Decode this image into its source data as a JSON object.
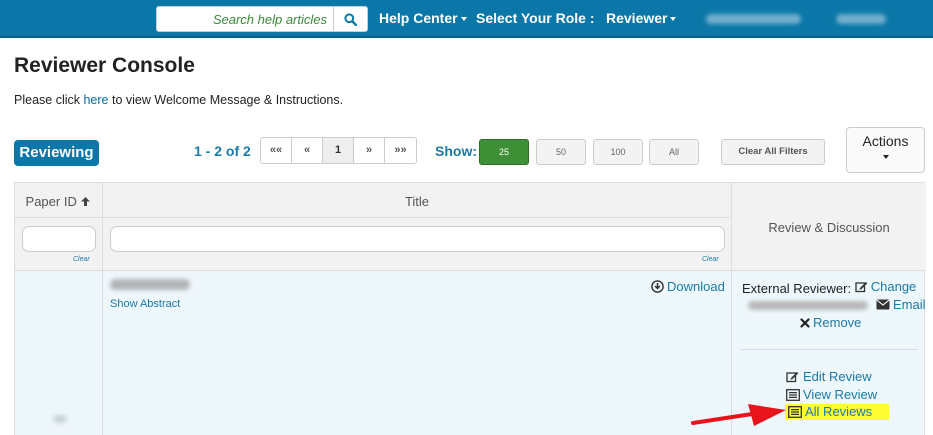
{
  "header": {
    "search_placeholder": "Search help articles",
    "help_center": "Help Center",
    "select_role_label": "Select Your Role :",
    "role": "Reviewer"
  },
  "page": {
    "title": "Reviewer Console",
    "welcome_prefix": "Please click ",
    "welcome_link": "here",
    "welcome_suffix": " to view Welcome Message & Instructions."
  },
  "toolbar": {
    "badge": "Reviewing",
    "range": "1 - 2 of 2",
    "pager": [
      "««",
      "«",
      "1",
      "»",
      "»»"
    ],
    "show_label": "Show:",
    "page_sizes": [
      "25",
      "50",
      "100",
      "All"
    ],
    "active_page_size": "25",
    "clear_filters": "Clear All Filters",
    "actions": "Actions"
  },
  "table": {
    "columns": {
      "paper_id": "Paper ID",
      "title": "Title",
      "review": "Review & Discussion"
    },
    "clear_label": "Clear",
    "row": {
      "show_abstract": "Show Abstract",
      "download": "Download",
      "external_reviewer": "External Reviewer:",
      "change": "Change",
      "email": "Email",
      "remove": "Remove",
      "edit_review": "Edit Review",
      "view_review": "View Review",
      "all_reviews": "All Reviews"
    }
  },
  "colors": {
    "navbar": "#0b77a8",
    "link": "#1a7aa8",
    "active_size": "#3f8f36",
    "highlight": "#ffff33",
    "arrow": "#e8141c"
  }
}
